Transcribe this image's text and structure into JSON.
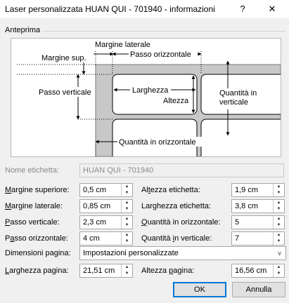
{
  "window": {
    "title": "Laser personalizzata HUAN QUI - 701940 - informazioni",
    "help_glyph": "?",
    "close_glyph": "✕"
  },
  "preview": {
    "group_label": "Anteprima",
    "labels": {
      "side_margin": "Margine laterale",
      "top_margin": "Margine sup.",
      "horizontal_pitch": "Passo orizzontale",
      "vertical_pitch": "Passo verticale",
      "width": "Larghezza",
      "height": "Altezza",
      "number_down_line1": "Quantità in",
      "number_down_line2": "verticale",
      "number_across": "Quantità in orizzontale"
    }
  },
  "form": {
    "label_name": "Nome etichetta:",
    "name_value": "HUAN QUI - 701940",
    "rows_left": [
      {
        "pre": "",
        "key": "M",
        "post": "argine superiore:",
        "value": "0,5 cm"
      },
      {
        "pre": "",
        "key": "M",
        "post": "argine laterale:",
        "value": "0,85 cm"
      },
      {
        "pre": "",
        "key": "P",
        "post": "asso verticale:",
        "value": "2,3 cm"
      },
      {
        "pre": "P",
        "key": "a",
        "post": "sso orizzontale:",
        "value": "4 cm"
      }
    ],
    "rows_right": [
      {
        "pre": "Al",
        "key": "t",
        "post": "ezza etichetta:",
        "value": "1,9 cm"
      },
      {
        "pre": "Lar",
        "key": "g",
        "post": "hezza etichetta:",
        "value": "3,8 cm"
      },
      {
        "pre": "",
        "key": "Q",
        "post": "uantità in orizzontale:",
        "value": "5"
      },
      {
        "pre": "Quantità ",
        "key": "i",
        "post": "n verticale:",
        "value": "7"
      }
    ],
    "label_page_size": "Dimensioni pagina:",
    "page_size_value": "Impostazioni personalizzate",
    "page_width": {
      "pre": "",
      "key": "L",
      "post": "arghezza pagina:",
      "value": "21,51 cm"
    },
    "page_height": {
      "pre": "Altezza ",
      "key": "p",
      "post": "agina:",
      "value": "16,56 cm"
    }
  },
  "buttons": {
    "ok": "OK",
    "cancel": "Annulla"
  },
  "icons": {
    "spin_up": "▲",
    "spin_down": "▼",
    "dropdown": "∨"
  }
}
